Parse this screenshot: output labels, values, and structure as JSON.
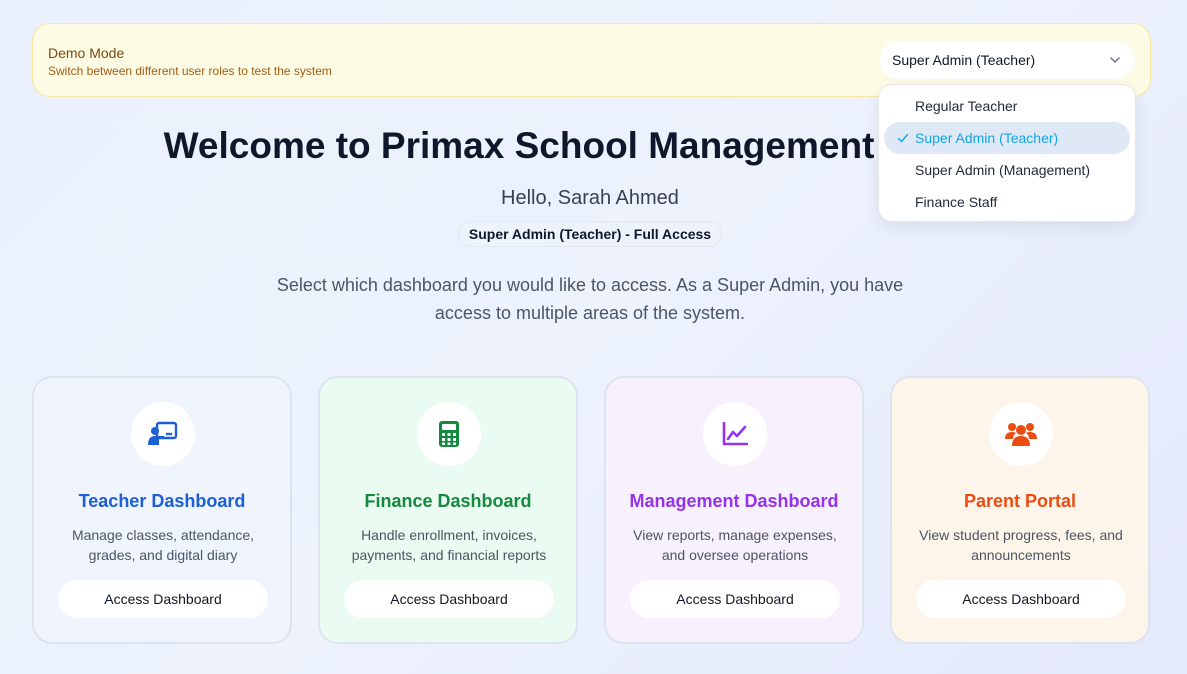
{
  "demo": {
    "title": "Demo Mode",
    "subtitle": "Switch between different user roles to test the system",
    "selected_role": "Super Admin (Teacher)",
    "options": [
      {
        "label": "Regular Teacher",
        "selected": false
      },
      {
        "label": "Super Admin (Teacher)",
        "selected": true
      },
      {
        "label": "Super Admin (Management)",
        "selected": false
      },
      {
        "label": "Finance Staff",
        "selected": false
      }
    ]
  },
  "header": {
    "welcome": "Welcome to Primax School Management System",
    "greeting": "Hello, Sarah Ahmed",
    "role_badge": "Super Admin (Teacher) - Full Access",
    "intro": "Select which dashboard you would like to access. As a Super Admin, you have access to multiple areas of the system."
  },
  "cards": [
    {
      "title": "Teacher Dashboard",
      "description": "Manage classes, attendance, grades, and digital diary",
      "button": "Access Dashboard",
      "icon": "teacher-board-icon",
      "accent": "#1d5fd6",
      "bg": "#eff4fd"
    },
    {
      "title": "Finance Dashboard",
      "description": "Handle enrollment, invoices, payments, and financial reports",
      "button": "Access Dashboard",
      "icon": "calculator-icon",
      "accent": "#15893d",
      "bg": "#eafbf2"
    },
    {
      "title": "Management Dashboard",
      "description": "View reports, manage expenses, and oversee operations",
      "button": "Access Dashboard",
      "icon": "chart-line-icon",
      "accent": "#9333ea",
      "bg": "#f7f0fd"
    },
    {
      "title": "Parent Portal",
      "description": "View student progress, fees, and announcements",
      "button": "Access Dashboard",
      "icon": "users-icon",
      "accent": "#ea4c12",
      "bg": "#fdf5ea"
    }
  ]
}
